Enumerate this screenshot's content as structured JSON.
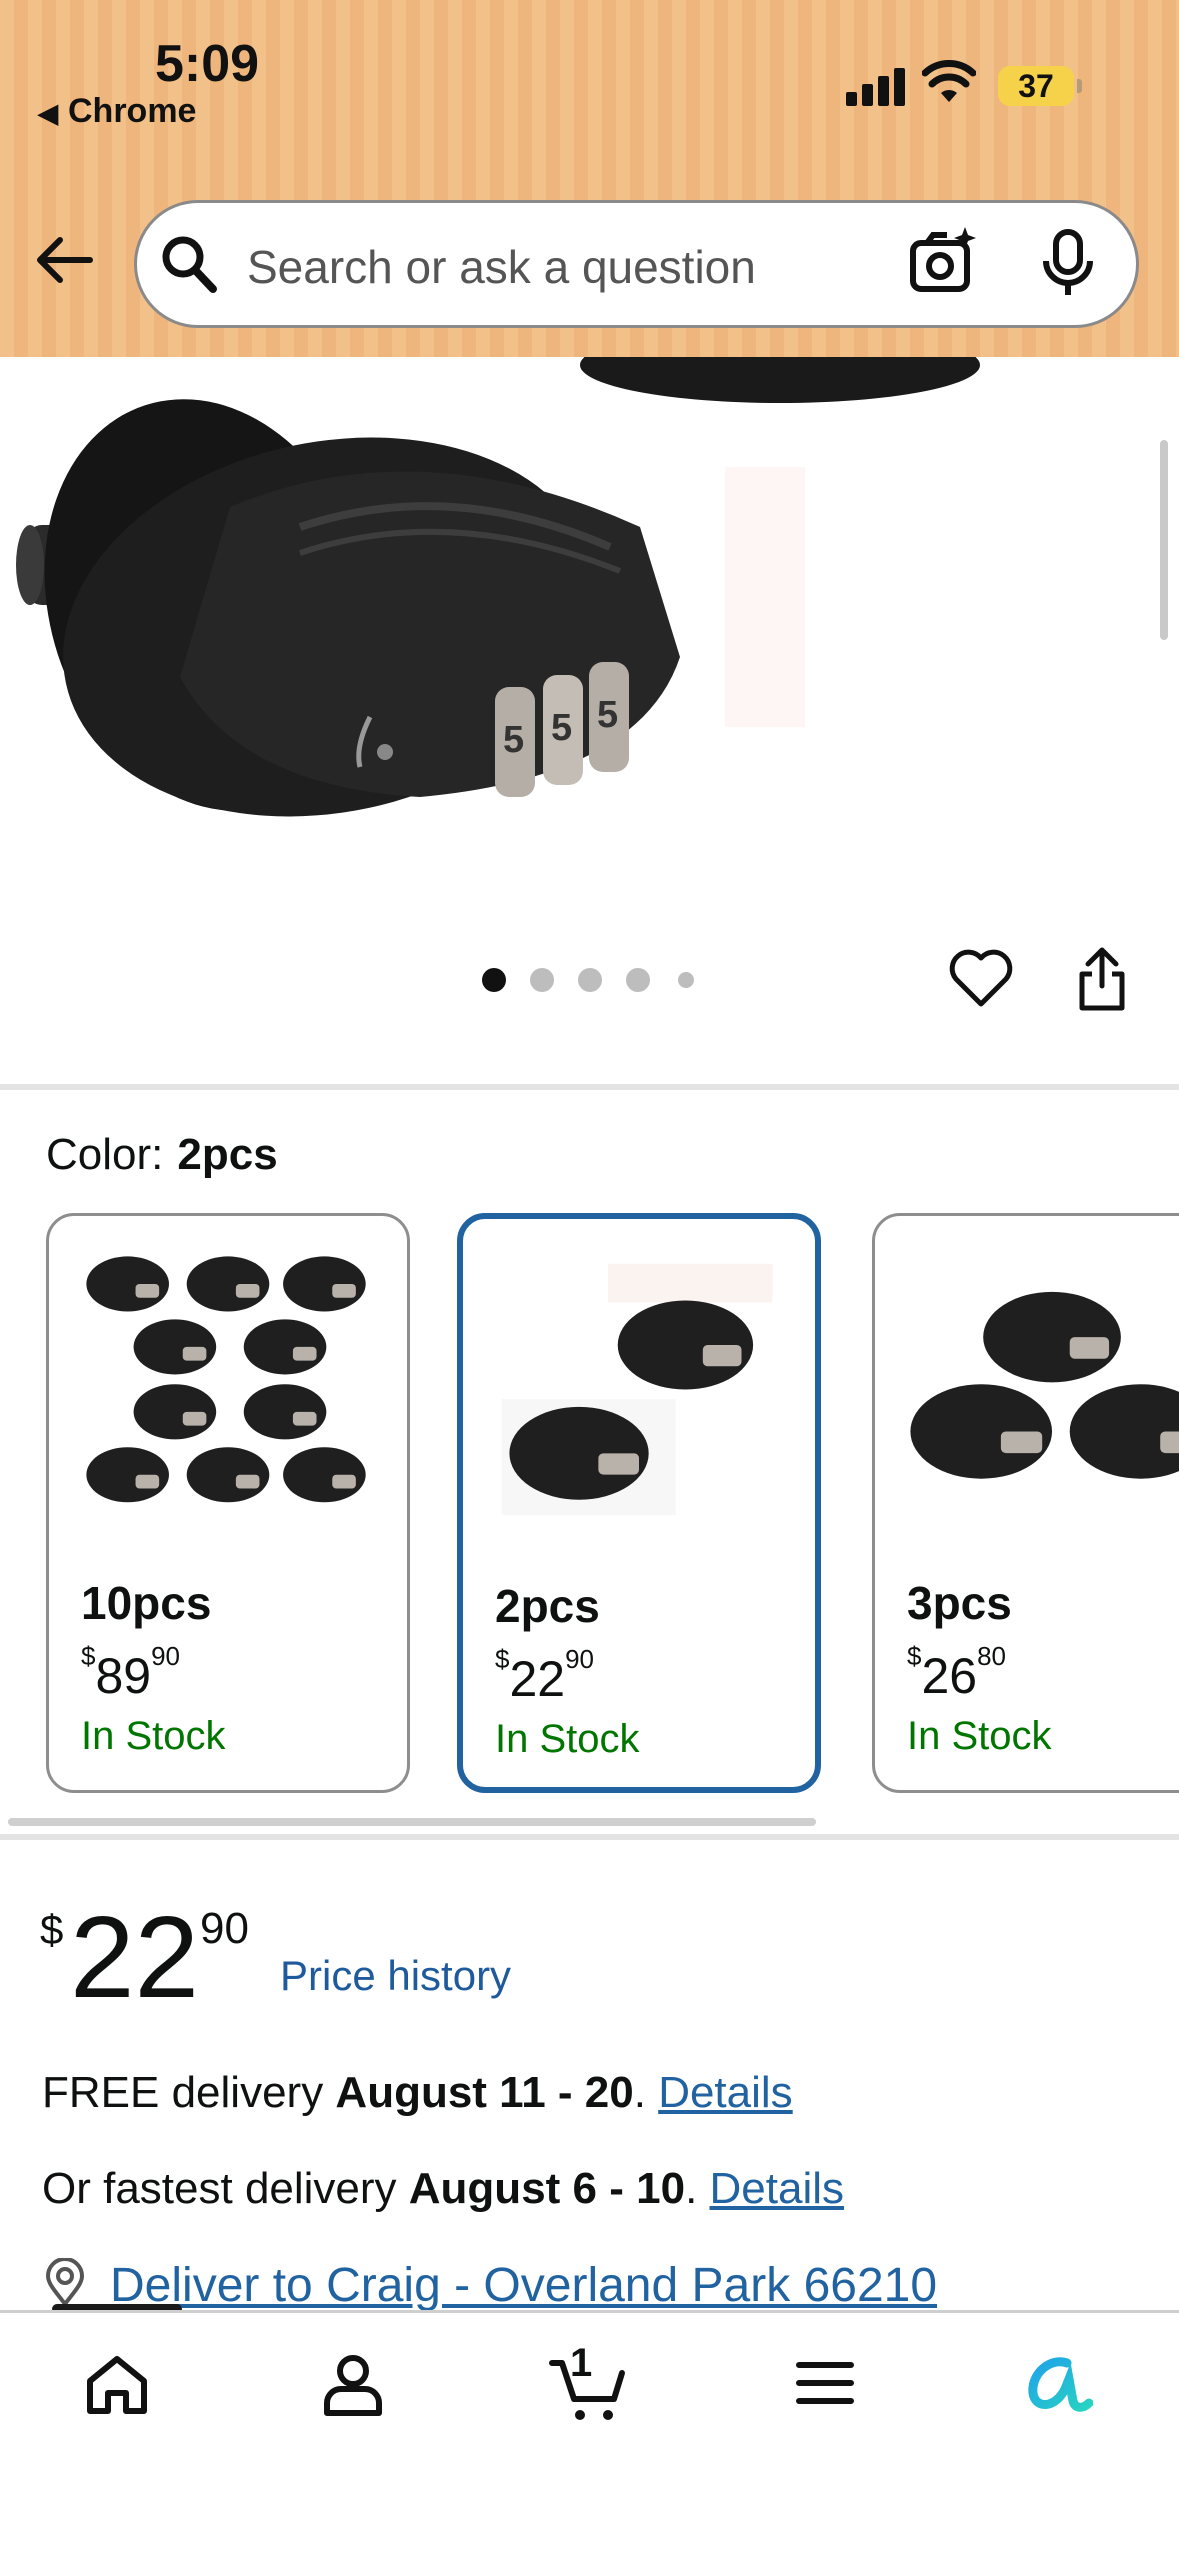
{
  "status_bar": {
    "time": "5:09",
    "back_app": "Chrome",
    "battery": "37"
  },
  "search": {
    "placeholder": "Search or ask a question"
  },
  "icons": {
    "back": "back-arrow-icon",
    "search": "search-icon",
    "camera": "camera-icon",
    "mic": "microphone-icon",
    "heart": "heart-icon",
    "share": "share-icon",
    "pin": "location-pin-icon",
    "home": "home-icon",
    "account": "account-icon",
    "cart": "cart-icon",
    "menu": "menu-icon",
    "rufus": "rufus-icon"
  },
  "gallery": {
    "dot_count": 5,
    "active_index": 0
  },
  "color": {
    "label": "Color:",
    "selected": "2pcs",
    "options": [
      {
        "name": "10pcs",
        "price_symbol": "$",
        "price_whole": "89",
        "price_fraction": "90",
        "stock": "In Stock"
      },
      {
        "name": "2pcs",
        "price_symbol": "$",
        "price_whole": "22",
        "price_fraction": "90",
        "stock": "In Stock"
      },
      {
        "name": "3pcs",
        "price_symbol": "$",
        "price_whole": "26",
        "price_fraction": "80",
        "stock": "In Stock"
      }
    ]
  },
  "price": {
    "symbol": "$",
    "whole": "22",
    "fraction": "90",
    "history_link": "Price history"
  },
  "delivery": {
    "free_prefix": "FREE delivery ",
    "free_dates": "August 11 - 20",
    "sep": ". ",
    "free_link": "Details",
    "fast_prefix": "Or fastest delivery ",
    "fast_dates": "August 6 - 10",
    "fast_link": "Details",
    "deliver_to": "Deliver to Craig - Overland Park 66210"
  },
  "tabbar": {
    "cart_count": "1"
  },
  "colors": {
    "header": "#f2c089",
    "link": "#2162a1",
    "stock": "#007600",
    "selected_border": "#2162a1"
  }
}
